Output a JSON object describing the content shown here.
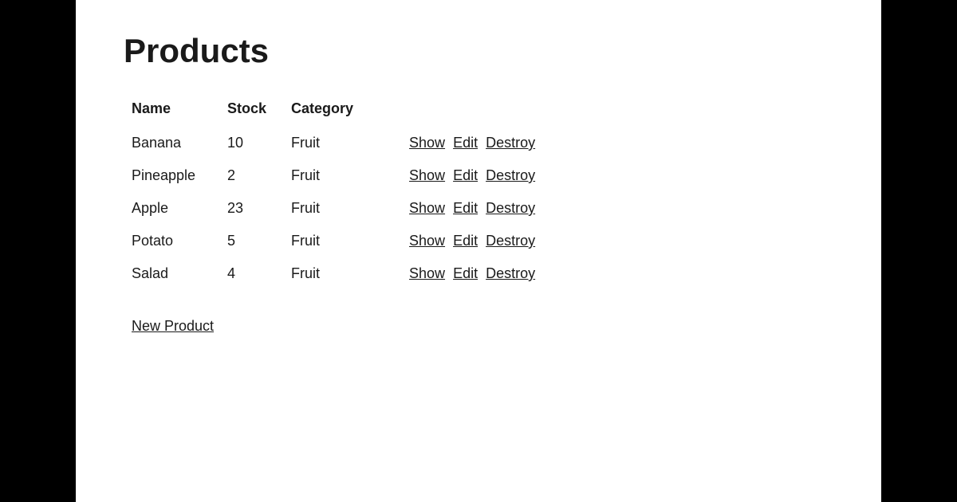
{
  "page": {
    "title": "Products"
  },
  "table": {
    "headers": {
      "name": "Name",
      "stock": "Stock",
      "category": "Category"
    },
    "rows": [
      {
        "id": 1,
        "name": "Banana",
        "stock": "10",
        "category": "Fruit"
      },
      {
        "id": 2,
        "name": "Pineapple",
        "stock": "2",
        "category": "Fruit"
      },
      {
        "id": 3,
        "name": "Apple",
        "stock": "23",
        "category": "Fruit"
      },
      {
        "id": 4,
        "name": "Potato",
        "stock": "5",
        "category": "Fruit"
      },
      {
        "id": 5,
        "name": "Salad",
        "stock": "4",
        "category": "Fruit"
      }
    ],
    "actions": {
      "show": "Show",
      "edit": "Edit",
      "destroy": "Destroy"
    }
  },
  "links": {
    "new_product": "New Product"
  }
}
